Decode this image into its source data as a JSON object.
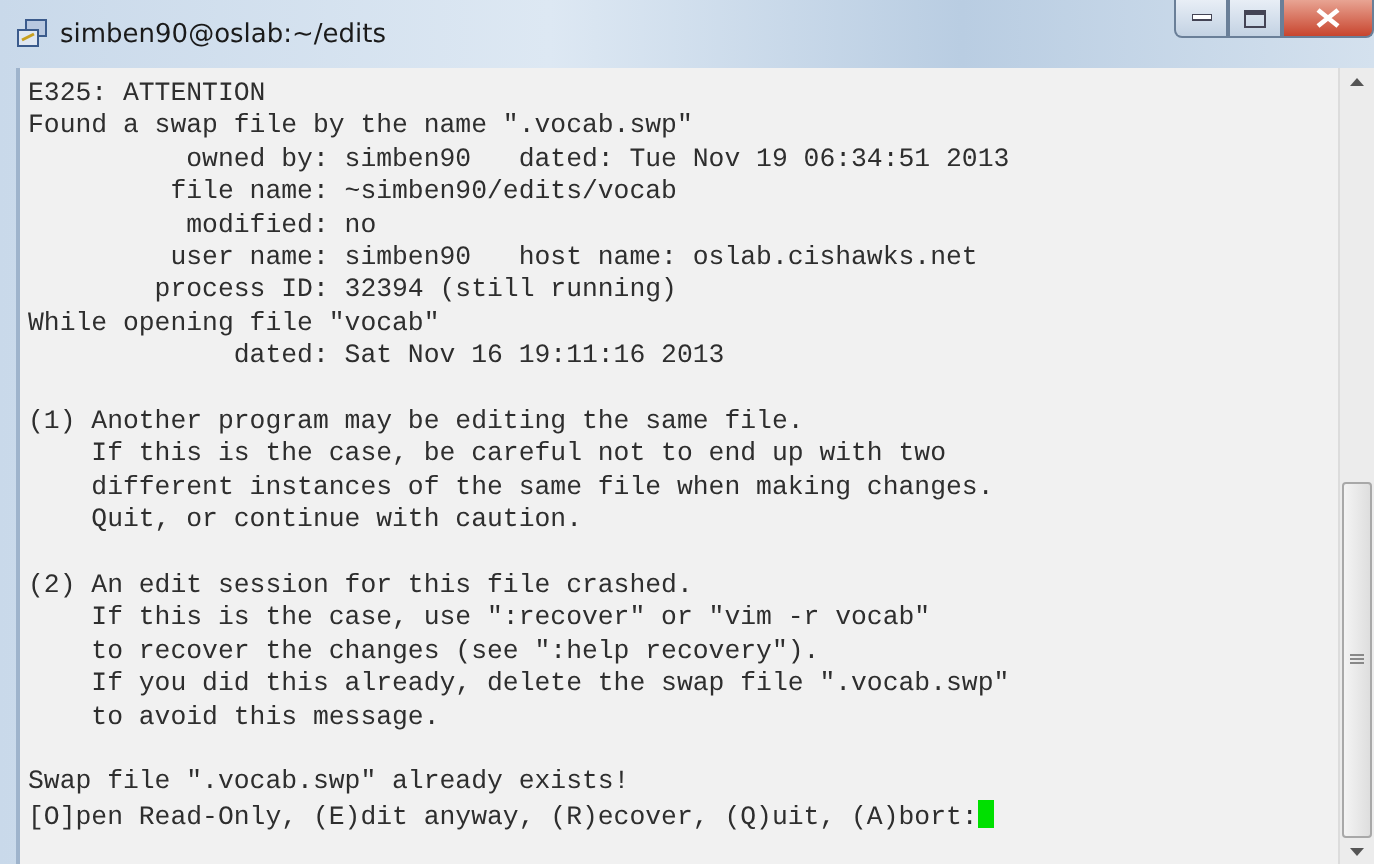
{
  "window": {
    "title": "simben90@oslab:~/edits"
  },
  "terminal": {
    "blocks": [
      [
        "E325: ATTENTION",
        "Found a swap file by the name \".vocab.swp\"",
        "          owned by: simben90   dated: Tue Nov 19 06:34:51 2013",
        "         file name: ~simben90/edits/vocab",
        "          modified: no",
        "         user name: simben90   host name: oslab.cishawks.net",
        "        process ID: 32394 (still running)",
        "While opening file \"vocab\"",
        "             dated: Sat Nov 16 19:11:16 2013"
      ],
      [
        "(1) Another program may be editing the same file.",
        "    If this is the case, be careful not to end up with two",
        "    different instances of the same file when making changes.",
        "    Quit, or continue with caution."
      ],
      [
        "(2) An edit session for this file crashed.",
        "    If this is the case, use \":recover\" or \"vim -r vocab\"",
        "    to recover the changes (see \":help recovery\").",
        "    If you did this already, delete the swap file \".vocab.swp\"",
        "    to avoid this message."
      ],
      [
        "Swap file \".vocab.swp\" already exists!",
        "[O]pen Read-Only, (E)dit anyway, (R)ecover, (Q)uit, (A)bort:"
      ]
    ]
  }
}
